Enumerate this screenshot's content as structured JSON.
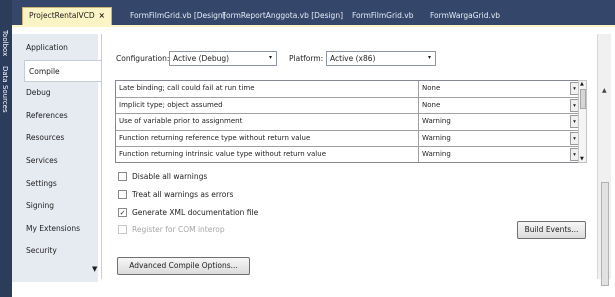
{
  "side_strip": {
    "items": [
      "Toolbox",
      "Data Sources"
    ]
  },
  "document_tabs": [
    {
      "label": "ProjectRentalVCD",
      "close": "×"
    },
    {
      "label": "FormFilmGrid.vb [Design]"
    },
    {
      "label": "FormReportAnggota.vb [Design]"
    },
    {
      "label": "FormFilmGrid.vb"
    },
    {
      "label": "FormWargaGrid.vb"
    }
  ],
  "nav": {
    "items": [
      "Application",
      "Compile",
      "Debug",
      "References",
      "Resources",
      "Services",
      "Settings",
      "Signing",
      "My Extensions",
      "Security"
    ],
    "selected": "Compile",
    "more": "▼"
  },
  "config": {
    "configuration_label": "Configuration:",
    "configuration_value": "Active (Debug)",
    "platform_label": "Platform:",
    "platform_value": "Active (x86)",
    "dropdown_glyph": "▾"
  },
  "warnings_grid": {
    "rows": [
      {
        "condition": "Late binding; call could fail at run time",
        "notification": "None"
      },
      {
        "condition": "Implicit type; object assumed",
        "notification": "None"
      },
      {
        "condition": "Use of variable prior to assignment",
        "notification": "Warning"
      },
      {
        "condition": "Function returning reference type without return value",
        "notification": "Warning"
      },
      {
        "condition": "Function returning intrinsic value type without return value",
        "notification": "Warning"
      }
    ],
    "dropdown_glyph": "▾"
  },
  "options": {
    "disable_all_warnings": {
      "label": "Disable all warnings",
      "checked": false
    },
    "treat_warnings_as_errors": {
      "label": "Treat all warnings as errors",
      "checked": false
    },
    "generate_xml_doc": {
      "label": "Generate XML documentation file",
      "checked": true,
      "mark": "✓"
    },
    "register_com_interop": {
      "label": "Register for COM interop",
      "checked": false,
      "disabled": true
    }
  },
  "buttons": {
    "build_events": "Build Events...",
    "advanced_compile": "Advanced Compile Options..."
  }
}
